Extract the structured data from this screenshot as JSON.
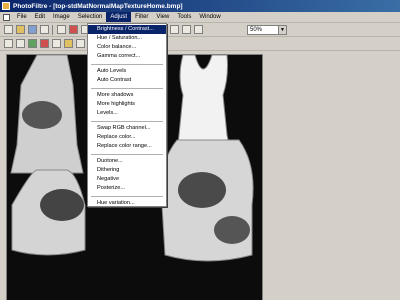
{
  "window": {
    "title": "PhotoFiltre - [top-stdMatNormalMapTextureHome.bmp]"
  },
  "menubar": {
    "items": [
      {
        "id": "file",
        "label": "File"
      },
      {
        "id": "edit",
        "label": "Edit"
      },
      {
        "id": "image",
        "label": "Image"
      },
      {
        "id": "selection",
        "label": "Selection"
      },
      {
        "id": "adjust",
        "label": "Adjust"
      },
      {
        "id": "filter",
        "label": "Filter"
      },
      {
        "id": "view",
        "label": "View"
      },
      {
        "id": "tools",
        "label": "Tools"
      },
      {
        "id": "window",
        "label": "Window"
      }
    ],
    "active": "Adjust"
  },
  "toolbar": {
    "zoom_value": "50%"
  },
  "adjust_menu": {
    "items": [
      "Brightness / Contrast...",
      "Hue / Saturation...",
      "Color balance...",
      "Gamma correct...",
      "—",
      "Auto Levels",
      "Auto Contrast",
      "—",
      "More shadows",
      "More highlights",
      "Levels...",
      "—",
      "Swap RGB channel...",
      "Replace color...",
      "Replace color range...",
      "—",
      "Duotone...",
      "Dithering",
      "Negative",
      "Posterize...",
      "—",
      "Hue variation..."
    ],
    "highlighted_index": 0
  },
  "colors": {
    "title_bar": "#0a246a",
    "menu_highlight": "#0a246a",
    "canvas_background": "#0c0c0c",
    "chrome": "#d4d0c8"
  }
}
